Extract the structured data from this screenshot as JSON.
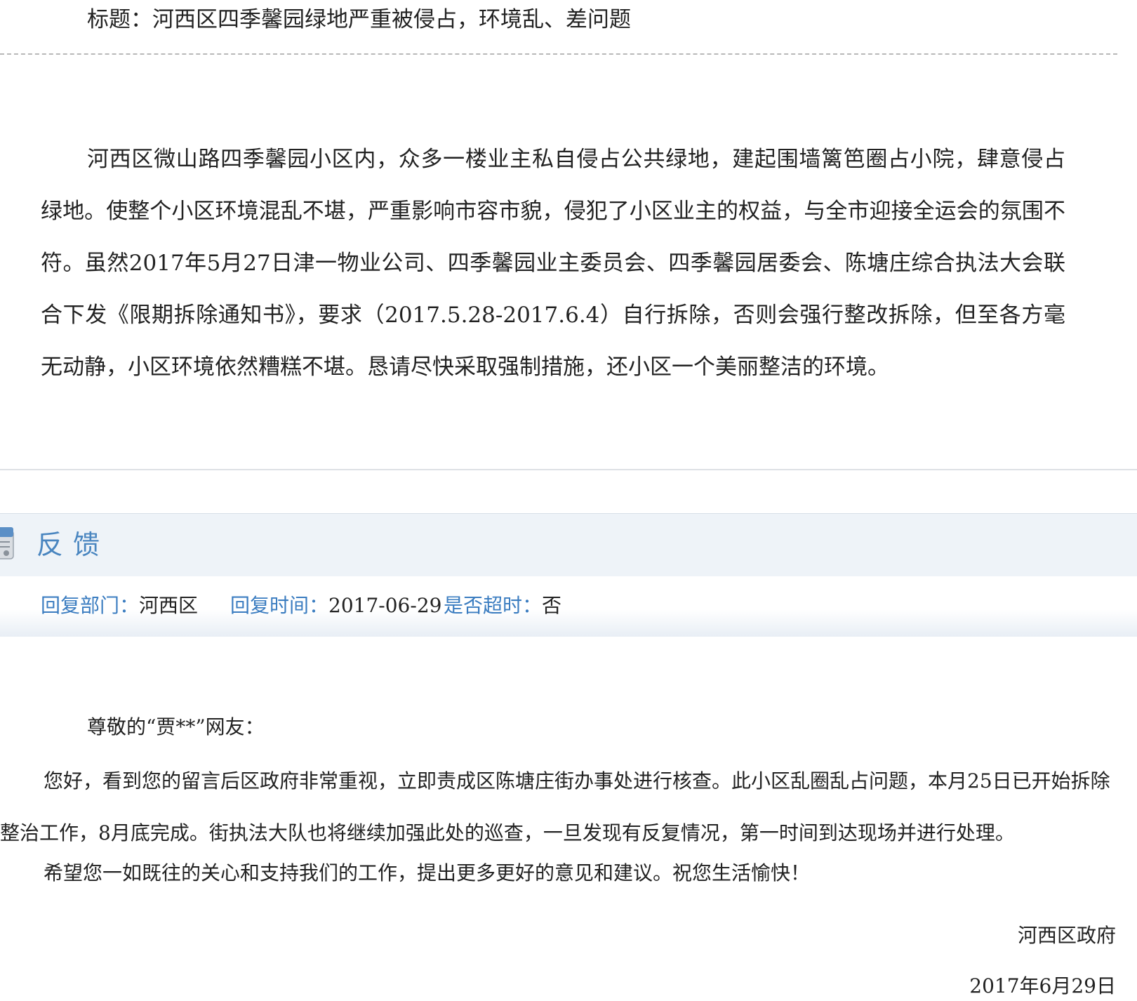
{
  "question": {
    "title": "标题：河西区四季馨园绿地严重被侵占，环境乱、差问题",
    "body": "河西区微山路四季馨园小区内，众多一楼业主私自侵占公共绿地，建起围墙篱笆圈占小院，肆意侵占绿地。使整个小区环境混乱不堪，严重影响市容市貌，侵犯了小区业主的权益，与全市迎接全运会的氛围不符。虽然2017年5月27日津一物业公司、四季馨园业主委员会、四季馨园居委会、陈塘庄综合执法大会联合下发《限期拆除通知书》，要求（2017.5.28-2017.6.4）自行拆除，否则会强行整改拆除，但至各方毫无动静，小区环境依然糟糕不堪。恳请尽快采取强制措施，还小区一个美丽整洁的环境。"
  },
  "feedback": {
    "heading": "反馈",
    "icon": "document-icon",
    "accent_color": "#4a86c0",
    "meta": {
      "dept_label": "回复部门：",
      "dept_value": "河西区",
      "time_label": "回复时间：",
      "time_value": "2017-06-29",
      "overdue_label": "是否超时：",
      "overdue_value": "否"
    },
    "reply": {
      "greeting": "尊敬的“贾**”网友：",
      "body": "您好，看到您的留言后区政府非常重视，立即责成区陈塘庄街办事处进行核查。此小区乱圈乱占问题，本月25日已开始拆除整治工作，8月底完成。街执法大队也将继续加强此处的巡查，一旦发现有反复情况，第一时间到达现场并进行处理。",
      "closing": "希望您一如既往的关心和支持我们的工作，提出更多更好的意见和建议。祝您生活愉快！",
      "signature": "河西区政府",
      "date": "2017年6月29日"
    }
  }
}
